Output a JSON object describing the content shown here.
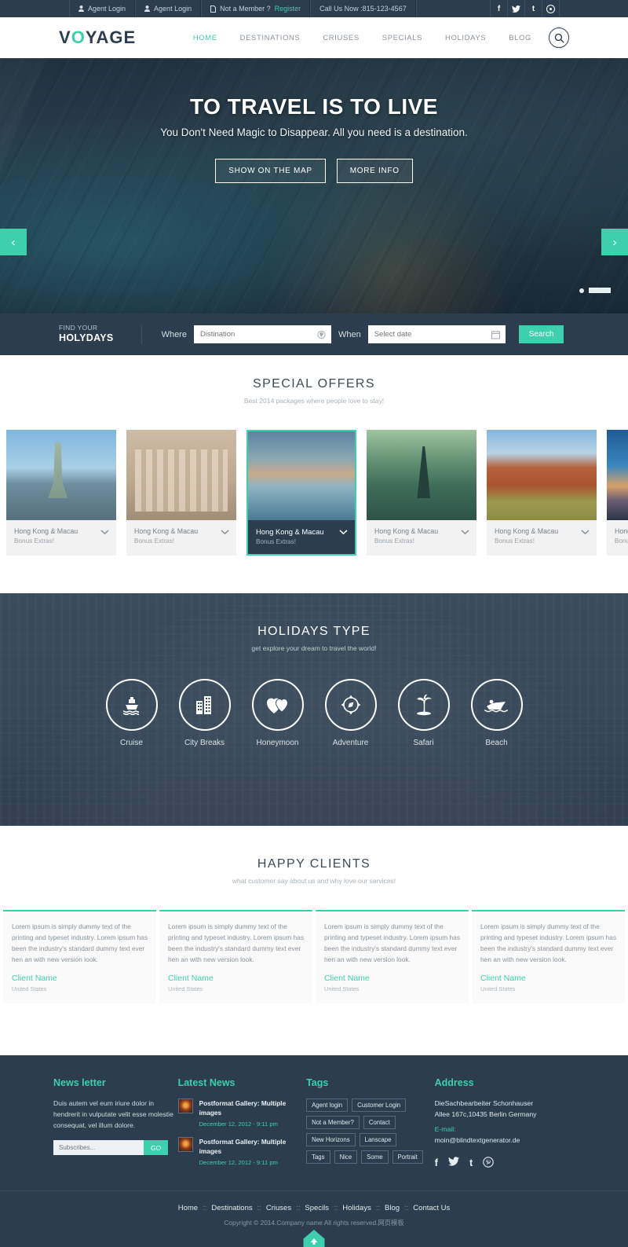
{
  "topbar": {
    "items": [
      {
        "icon": "user-icon",
        "label": "Agent Login"
      },
      {
        "icon": "user-icon",
        "label": "Agent Login"
      },
      {
        "icon": "file-icon",
        "label": "Not a Member ?",
        "link": "Register"
      }
    ],
    "phone": "Call Us Now :815-123-4567",
    "socials": [
      "facebook-icon",
      "twitter-icon",
      "tumblr-icon",
      "pinterest-icon"
    ]
  },
  "header": {
    "logo_first": "V",
    "logo_o": "O",
    "logo_rest": "YAGE",
    "nav": [
      {
        "label": "HOME",
        "active": true
      },
      {
        "label": "DESTINATIONS",
        "active": false
      },
      {
        "label": "CRIUSES",
        "active": false
      },
      {
        "label": "SPECIALS",
        "active": false
      },
      {
        "label": "HOLIDAYS",
        "active": false
      },
      {
        "label": "BLOG",
        "active": false
      }
    ],
    "search_icon": "search-icon"
  },
  "hero": {
    "title": "TO TRAVEL IS TO LIVE",
    "subtitle": "You Don't Need Magic to Disappear. All you need is a destination.",
    "btn_map": "SHOW ON THE MAP",
    "btn_info": "MORE INFO",
    "prev": "‹",
    "next": "›"
  },
  "findbar": {
    "label_line1": "FIND YOUR",
    "label_line2": "HOLYDAYS",
    "where_label": "Where",
    "where_placeholder": "Distination",
    "where_value": "",
    "when_label": "When",
    "when_placeholder": "Select date",
    "when_value": "",
    "search_button": "Search"
  },
  "offers": {
    "title": "SPECIAL OFFERS",
    "subtitle": "Best 2014 packages where people love to stay!",
    "cards": [
      {
        "name": "Hong Kong & Macau",
        "bonus": "Bonus Extras!",
        "img": "img-liberty",
        "active": false
      },
      {
        "name": "Hong Kong & Macau",
        "bonus": "Bonus Extras!",
        "img": "img-trevi",
        "active": false
      },
      {
        "name": "Hong Kong & Macau",
        "bonus": "Bonus Extras!",
        "img": "img-harbor",
        "active": true
      },
      {
        "name": "Hong Kong & Macau",
        "bonus": "Bonus Extras!",
        "img": "img-eiffel",
        "active": false
      },
      {
        "name": "Hong Kong & Macau",
        "bonus": "Bonus Extras!",
        "img": "img-canyon",
        "active": false
      },
      {
        "name": "Hong Kong & Macau",
        "bonus": "Bonus Extras!",
        "img": "img-sunset",
        "active": false
      }
    ]
  },
  "holidays": {
    "title": "HOLIDAYS TYPE",
    "subtitle": "get explore your dream to travel the world!",
    "types": [
      {
        "label": "Cruise",
        "icon": "ship-icon"
      },
      {
        "label": "City Breaks",
        "icon": "buildings-icon"
      },
      {
        "label": "Honeymoon",
        "icon": "hearts-icon"
      },
      {
        "label": "Adventure",
        "icon": "compass-icon"
      },
      {
        "label": "Safari",
        "icon": "palm-tree-icon"
      },
      {
        "label": "Beach",
        "icon": "speedboat-icon"
      }
    ]
  },
  "clients": {
    "title": "HAPPY CLIENTS",
    "subtitle": "what customer say about us and why love our services!",
    "testimonials": [
      {
        "text": "Lorem ipsum is simply dummy text of the printing and typeset industry. Lorem ipsum has been the industry's standard dummy text ever hen an with new version look.",
        "name": "Client Name",
        "location": "United States"
      },
      {
        "text": "Lorem ipsum is simply dummy text of the printing and typeset industry. Lorem ipsum has been the industry's standard dummy text ever hen an with new version look.",
        "name": "Client Name",
        "location": "United States"
      },
      {
        "text": "Lorem ipsum is simply dummy text of the printing and typeset industry. Lorem ipsum has been the industry's standard dummy text ever hen an with new version look.",
        "name": "Client Name",
        "location": "United States"
      },
      {
        "text": "Lorem ipsum is simply dummy text of the printing and typeset industry. Lorem ipsum has been the industry's standard dummy text ever hen an with new version look.",
        "name": "Client Name",
        "location": "United States"
      }
    ]
  },
  "footer": {
    "newsletter": {
      "title": "News letter",
      "text": "Duis autem vel eum iriure dolor in hendrerit in vulputate velit esse molestie consequat, vel illum dolore.",
      "input_placeholder": "Subscribes...",
      "input_value": "",
      "button": "GO"
    },
    "latest_news": {
      "title": "Latest News",
      "items": [
        {
          "title": "Postformat Gallery: Multiple images",
          "date": "December 12, 2012 - 9:11 pm"
        },
        {
          "title": "Postformat Gallery: Multiple images",
          "date": "December 12, 2012 - 9:11 pm"
        }
      ]
    },
    "tags": {
      "title": "Tags",
      "items": [
        "Agent login",
        "Customer Login",
        "Not a Member?",
        "Contact",
        "New Horizons",
        "Lanscape",
        "Tags",
        "Nice",
        "Some",
        "Portrait"
      ]
    },
    "address": {
      "title": "Address",
      "line1": "DieSachbearbeiter Schonhauser",
      "line2": "Allee 167c,10435 Berlin Germany",
      "email_label": "E-mail:",
      "email": "moin@blindtextgenerator.de",
      "socials": [
        "facebook-icon",
        "twitter-icon",
        "tumblr-icon",
        "pinterest-icon"
      ]
    }
  },
  "bottom": {
    "nav": [
      "Home",
      "Destinations",
      "Criuses",
      "Specils",
      "Holidays",
      "Blog",
      "Contact Us"
    ],
    "separator": "::",
    "copyright": "Copyright © 2014.Company name All rights reserved.网页模板",
    "to_top": "▲"
  },
  "colors": {
    "accent": "#3ecfad",
    "dark": "#2b3d4f"
  }
}
